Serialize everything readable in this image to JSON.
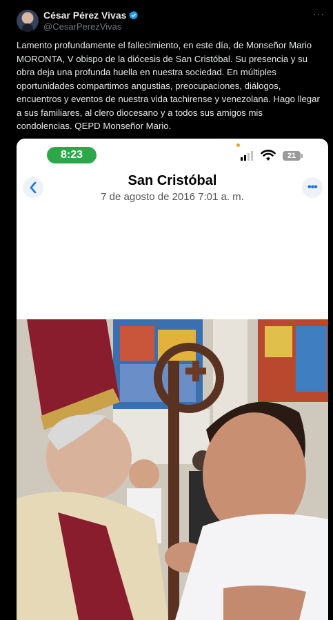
{
  "tweet": {
    "display_name": "César Pérez Vivas",
    "handle": "@CesarPerezVivas",
    "more": "···",
    "text": "Lamento profundamente el fallecimiento, en este día,  de  Monseñor Mario MORONTA, V obispo de la diócesis de San Cristóbal. Su presencia y su obra deja una profunda huella en nuestra sociedad. En múltiples oportunidades compartimos angustias, preocupaciones, diálogos, encuentros y eventos de nuestra vida tachirense y venezolana. Hago llegar a sus familiares, al clero diocesano y a todos sus amigos mis condolencias. QEPD Monseñor Mario."
  },
  "phone": {
    "time": "8:23",
    "battery": "21",
    "back_icon": "chevron-left-icon",
    "options": "•••",
    "album_title": "San Cristóbal",
    "album_date": "7 de agosto de 2016  7:01 a. m."
  },
  "colors": {
    "background": "#000000",
    "verified": "#1d9bf0",
    "status_green": "#2aa84a",
    "ios_blue": "#1a73e8"
  }
}
